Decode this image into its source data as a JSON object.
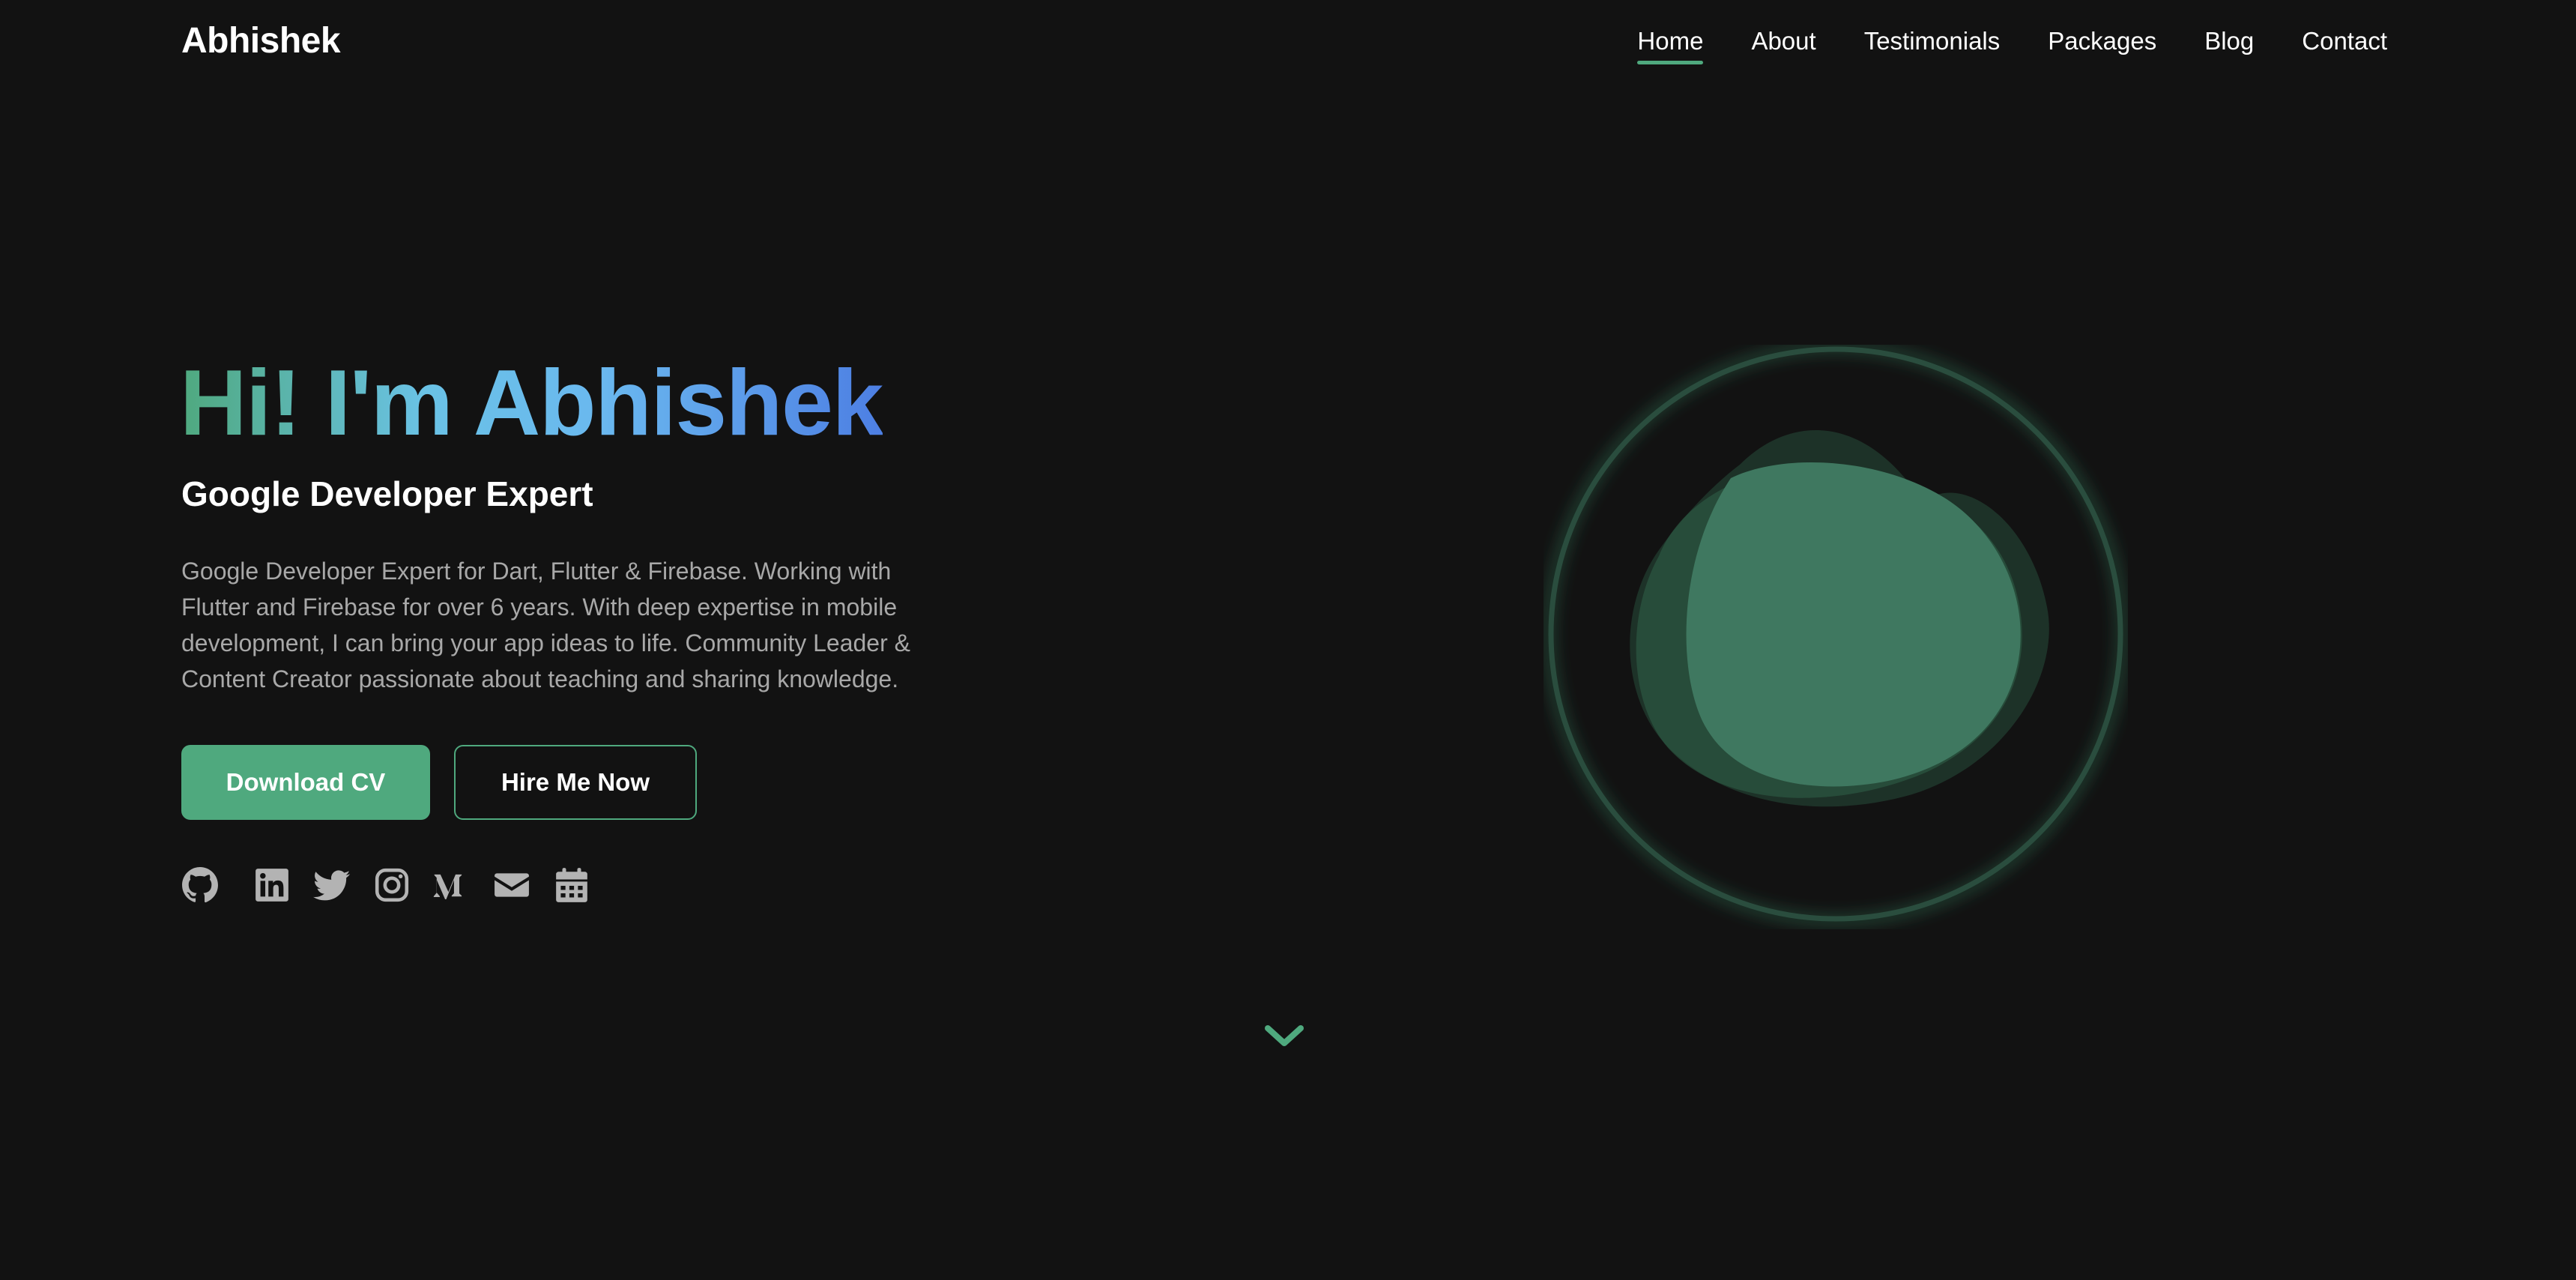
{
  "brand": "Abhishek",
  "nav": {
    "items": [
      {
        "label": "Home",
        "active": true
      },
      {
        "label": "About"
      },
      {
        "label": "Testimonials"
      },
      {
        "label": "Packages"
      },
      {
        "label": "Blog"
      },
      {
        "label": "Contact"
      }
    ]
  },
  "hero": {
    "title": "Hi! I'm Abhishek",
    "subtitle": "Google Developer Expert",
    "description": "Google Developer Expert for Dart, Flutter & Firebase. Working with Flutter and Firebase for over 6 years. With deep expertise in mobile development, I can bring your app ideas to life. Community Leader & Content Creator passionate about teaching and sharing knowledge.",
    "primary_button": "Download CV",
    "secondary_button": "Hire Me Now"
  },
  "social": [
    {
      "icon": "github-icon"
    },
    {
      "icon": "linkedin-icon"
    },
    {
      "icon": "twitter-icon"
    },
    {
      "icon": "instagram-icon"
    },
    {
      "icon": "medium-icon"
    },
    {
      "icon": "email-icon"
    },
    {
      "icon": "calendar-icon"
    }
  ],
  "scroll_icon": "chevron-down-icon",
  "colors": {
    "background": "#121212",
    "accent": "#4fa97e",
    "gradient_start": "#4fa97e",
    "gradient_mid": "#6ac2e6",
    "gradient_end": "#4d7fe3",
    "muted_text": "#a8a8a8",
    "icon": "#b3b3b3"
  }
}
